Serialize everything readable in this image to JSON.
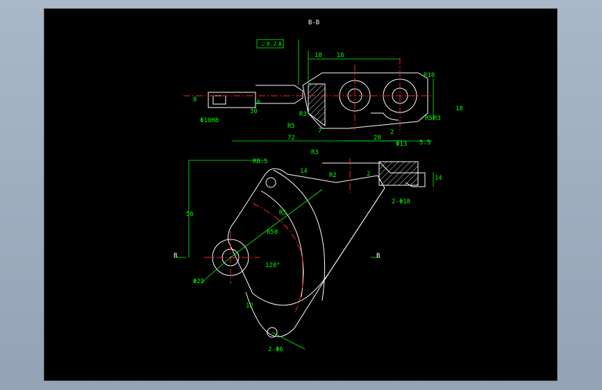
{
  "view_label": "B-B",
  "section_marker": "B",
  "flatness_tolerance": {
    "symbol": "⌰",
    "value": "0.2",
    "datum": "A"
  },
  "dims": {
    "d10": "10",
    "d16": "16",
    "r10": "R10",
    "d8": "8",
    "d6": "6",
    "d30": "30",
    "r3": "R3",
    "r5": "R5",
    "d7": "7",
    "d72": "72",
    "d28": "28",
    "d18": "18",
    "r5b": "R5",
    "r3b": "R3",
    "d5": "5.5",
    "d2": "2",
    "phi10": "Φ10H8",
    "r8_5": "R8.5",
    "d14": "14",
    "r3c": "R3",
    "r2": "R2",
    "phi13": "Φ13",
    "d14b": "14",
    "d2_phi18": "2-Φ18",
    "d56": "56",
    "r50": "R50",
    "r35": "R5",
    "a120": "120°",
    "phi25": "Φ25",
    "d12": "12",
    "holes": "2-Φ6",
    "d2b": "2"
  },
  "colors": {
    "outline": "#ffffff",
    "dimension": "#00ff00",
    "centerline": "#ff0000",
    "text": "#ffffff"
  }
}
